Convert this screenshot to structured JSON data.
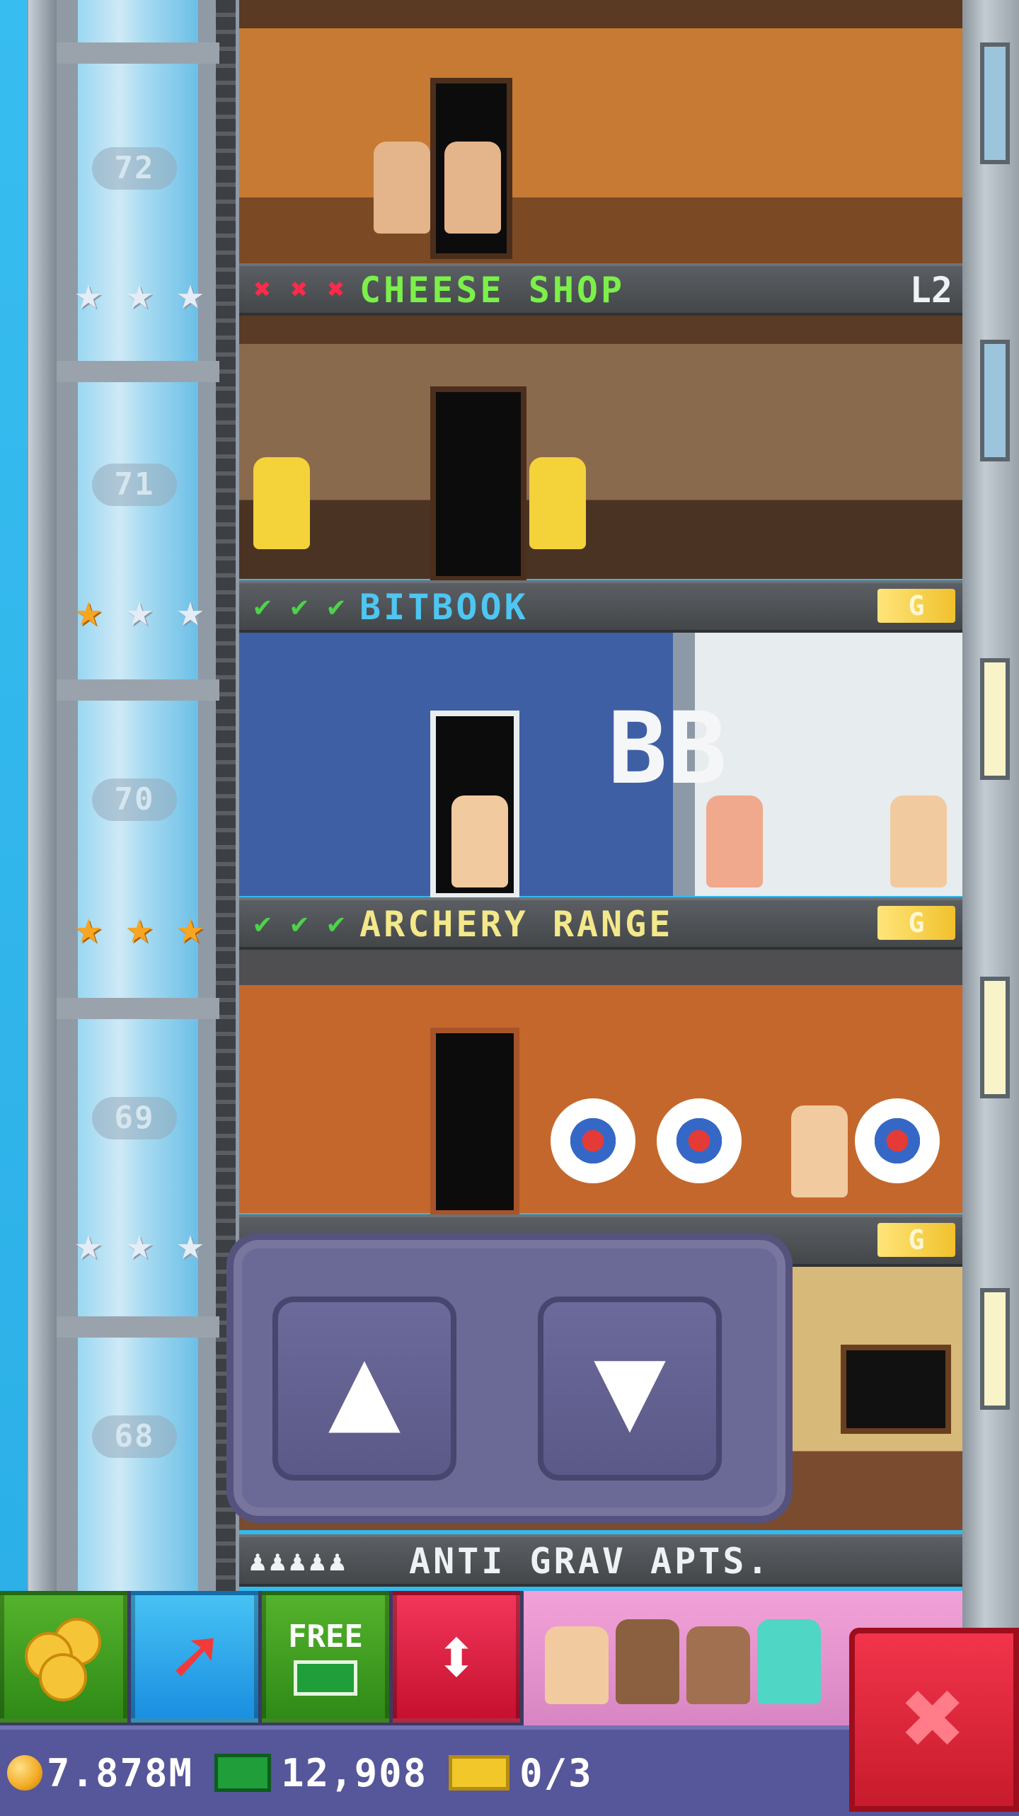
{
  "elevator": {
    "floors": [
      {
        "number": "72",
        "stars": [
          "silver",
          "silver",
          "silver"
        ]
      },
      {
        "number": "71",
        "stars": [
          "gold",
          "silver",
          "silver"
        ]
      },
      {
        "number": "70",
        "stars": [
          "gold",
          "gold",
          "gold"
        ]
      },
      {
        "number": "69",
        "stars": [
          "silver",
          "silver",
          "silver"
        ]
      },
      {
        "number": "68"
      }
    ]
  },
  "floors": {
    "cheese_shop": {
      "title": "CHEESE SHOP",
      "checks": [
        "✖",
        "✖",
        "✖"
      ],
      "tag": "L2"
    },
    "bitbook": {
      "title": "BITBOOK",
      "checks": [
        "✔",
        "✔",
        "✔"
      ],
      "tag": "G",
      "sign": "BB"
    },
    "archery_range": {
      "title": "ARCHERY RANGE",
      "checks": [
        "✔",
        "✔",
        "✔"
      ],
      "tag": "G"
    },
    "hidden_floor": {
      "checks": [
        "✖"
      ],
      "tag": "G"
    },
    "anti_grav": {
      "title": "ANTI GRAV APTS.",
      "residents": "♟♟♟♟♟"
    }
  },
  "controls": {
    "up_icon": "▲",
    "down_icon": "▼"
  },
  "toolbar": {
    "free_label": "FREE",
    "elevator_icon": "⬍"
  },
  "status": {
    "coins": "7.878M",
    "bux": "12,908",
    "tickets": "0/3"
  },
  "close_icon": "✖",
  "colors": {
    "gold_star": "#f7a623",
    "silver_star": "#e4ecf5",
    "check_ok": "#4cd34a",
    "check_bad": "#ff2a4a",
    "cheese_title": "#7cf04a",
    "bitbook_title": "#4ec6f2",
    "archery_title": "#f3e88a",
    "anti_grav_title": "#eef2f5"
  }
}
